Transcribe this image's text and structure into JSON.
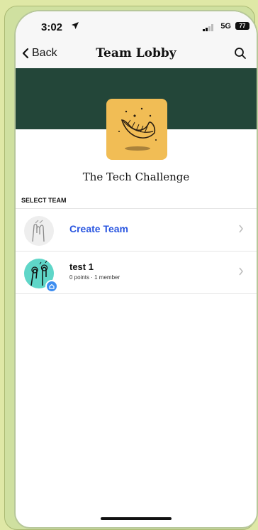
{
  "status_bar": {
    "time": "3:02",
    "network": "5G",
    "battery": "77"
  },
  "nav": {
    "back_label": "Back",
    "title": "Team Lobby"
  },
  "challenge": {
    "name": "The Tech Challenge"
  },
  "section_label": "SELECT TEAM",
  "rows": [
    {
      "label": "Create Team"
    },
    {
      "name": "test 1",
      "meta": "0 points · 1 member"
    }
  ],
  "colors": {
    "banner": "#234639",
    "logo_bg": "#f1bd55",
    "link": "#2a56e0",
    "page_bg": "#dfe8a6"
  },
  "icons": [
    "location-arrow-icon",
    "signal-icon",
    "battery-icon",
    "chevron-left-icon",
    "search-icon",
    "chevron-right-icon",
    "feather-logo",
    "hands-avatar",
    "home-badge-icon"
  ]
}
